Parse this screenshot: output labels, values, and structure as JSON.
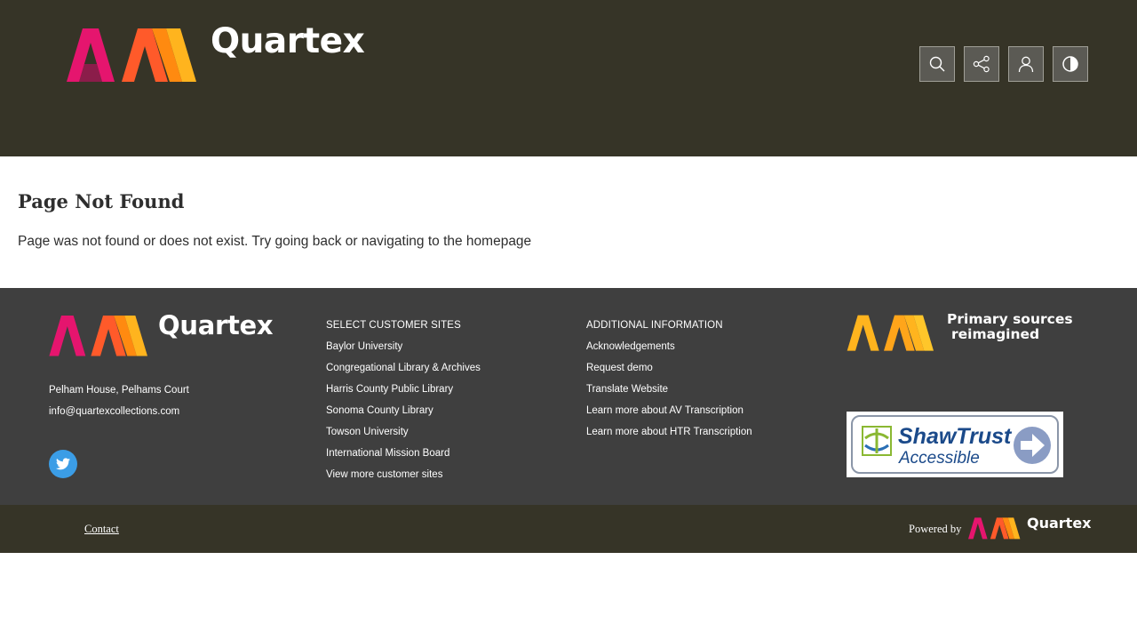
{
  "header": {
    "logo_text": "Quartex",
    "tools": [
      {
        "icon": "search-icon"
      },
      {
        "icon": "share-icon"
      },
      {
        "icon": "user-icon"
      },
      {
        "icon": "contrast-icon"
      }
    ]
  },
  "main": {
    "title": "Page Not Found",
    "message": "Page was not found or does not exist. Try going back or navigating to the homepage"
  },
  "footer": {
    "logo_text": "Quartex",
    "address": "Pelham House, Pelhams Court",
    "email": "info@quartexcollections.com",
    "social": {
      "icon": "twitter-icon"
    },
    "customer_sites": {
      "heading": "SELECT CUSTOMER SITES",
      "links": [
        "Baylor University",
        "Congregational Library & Archives",
        "Harris County Public Library",
        "Sonoma County Library",
        "Towson University",
        "International Mission Board",
        "View more customer sites"
      ]
    },
    "additional_info": {
      "heading": "ADDITIONAL INFORMATION",
      "links": [
        "Acknowledgements",
        "Request demo",
        "Translate Website",
        "Learn more about AV Transcription",
        "Learn more about HTR Transcription"
      ]
    },
    "tagline": {
      "line1": "Primary sources",
      "line2": "reimagined"
    },
    "badge": {
      "name": "ShawTrust",
      "sub": "Accessible"
    }
  },
  "bottom": {
    "contact": "Contact",
    "powered_by": "Powered by",
    "logo_text": "Quartex"
  },
  "colors": {
    "header_bg": "#363427",
    "footer_bg": "#3f3f3f",
    "pink": "#e5156e",
    "orange": "#ff7a12",
    "yellow": "#ffb41e",
    "twitter": "#3b9de6"
  }
}
